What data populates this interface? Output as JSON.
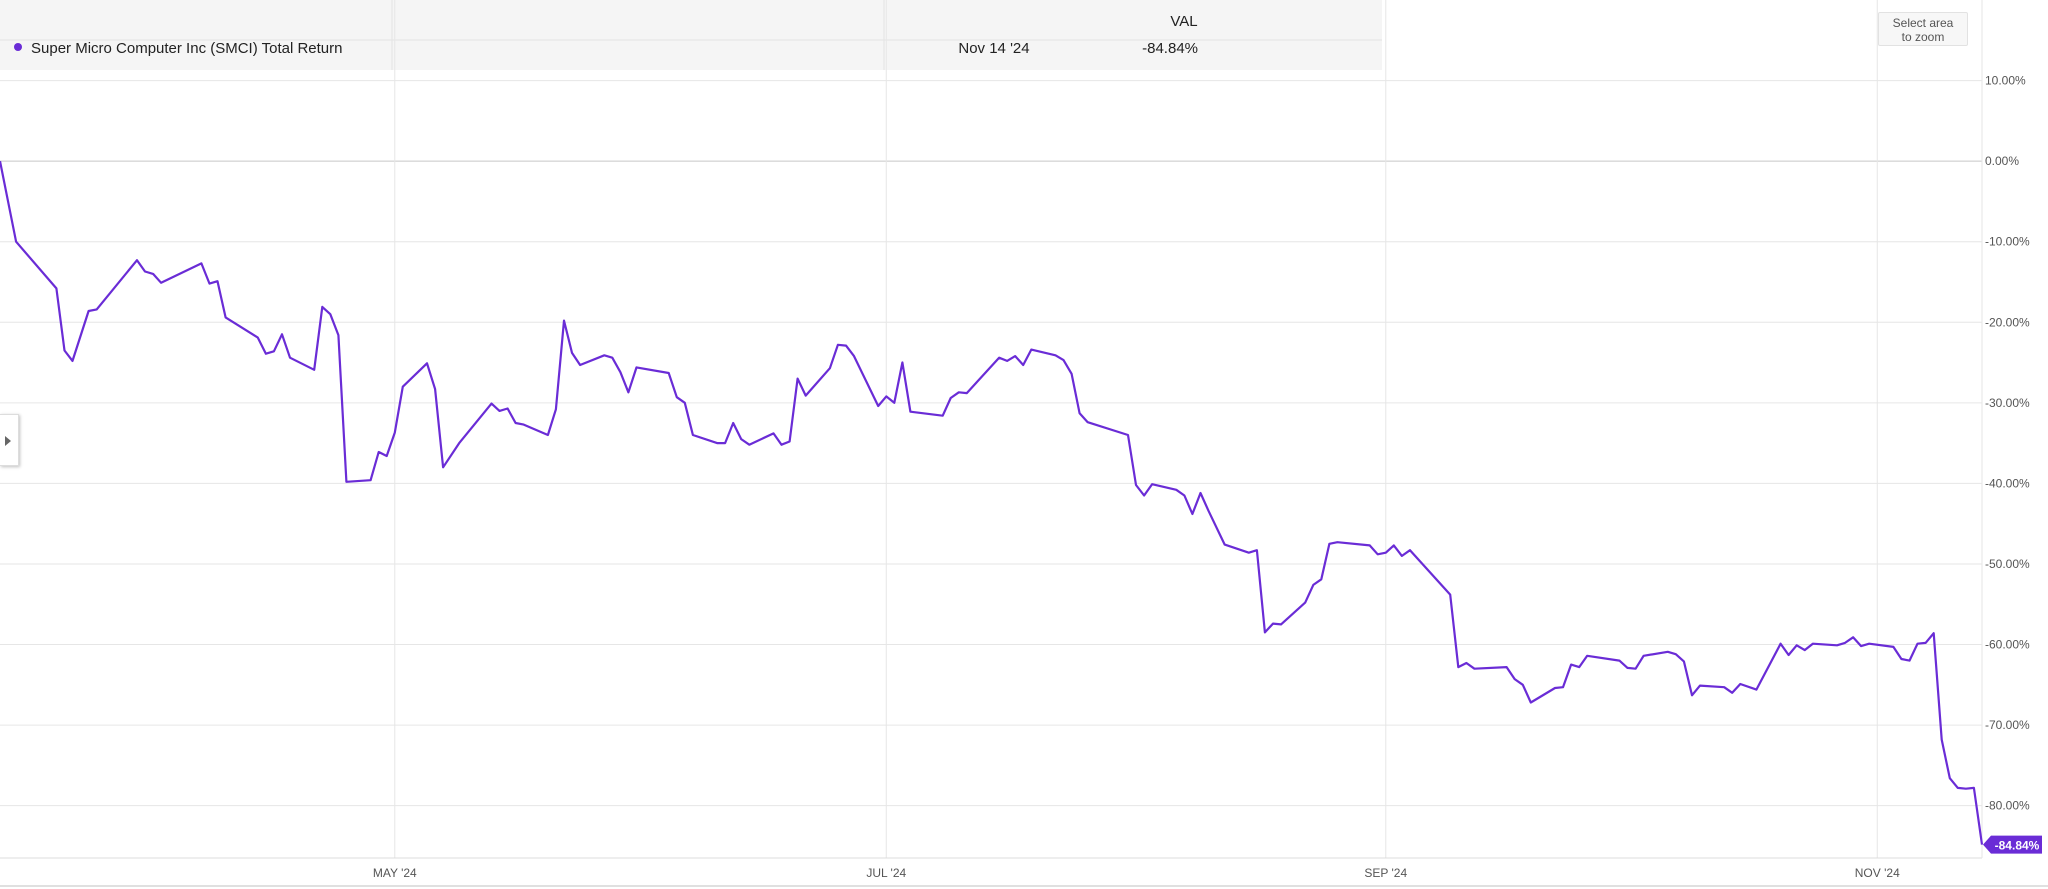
{
  "colors": {
    "series": "#6a2cd6",
    "grid": "#e6e6e6",
    "zero": "#c8c8c8",
    "badge": "#6a2cd6"
  },
  "legend": {
    "series_label": "Super Micro Computer Inc (SMCI) Total Return",
    "column_header": "VAL",
    "date": "Nov 14 '24",
    "value": "-84.84%"
  },
  "zoom_hint": {
    "line1": "Select area",
    "line2": "to zoom"
  },
  "chart_data": {
    "type": "line",
    "xlabel": "",
    "ylabel": "",
    "x_ticks": [
      {
        "label": "MAY '24",
        "date": "2024-05-01"
      },
      {
        "label": "JUL '24",
        "date": "2024-07-01"
      },
      {
        "label": "SEP '24",
        "date": "2024-09-01"
      },
      {
        "label": "NOV '24",
        "date": "2024-11-01"
      }
    ],
    "y_ticks": [
      {
        "label": "10.00%",
        "value": 10
      },
      {
        "label": "0.00%",
        "value": 0
      },
      {
        "label": "-10.00%",
        "value": -10
      },
      {
        "label": "-20.00%",
        "value": -20
      },
      {
        "label": "-30.00%",
        "value": -30
      },
      {
        "label": "-40.00%",
        "value": -40
      },
      {
        "label": "-50.00%",
        "value": -50
      },
      {
        "label": "-60.00%",
        "value": -60
      },
      {
        "label": "-70.00%",
        "value": -70
      },
      {
        "label": "-80.00%",
        "value": -80
      }
    ],
    "xlim": [
      "2024-03-13",
      "2024-11-14"
    ],
    "ylim": [
      -86.5,
      20
    ],
    "last_value_label": "-84.84%",
    "series": [
      {
        "name": "Super Micro Computer Inc (SMCI) Total Return",
        "points": [
          [
            "2024-03-13",
            0.0
          ],
          [
            "2024-03-15",
            -10.0
          ],
          [
            "2024-03-20",
            -15.8
          ],
          [
            "2024-03-21",
            -23.5
          ],
          [
            "2024-03-22",
            -24.8
          ],
          [
            "2024-03-24",
            -18.6
          ],
          [
            "2024-03-25",
            -18.4
          ],
          [
            "2024-03-30",
            -12.3
          ],
          [
            "2024-03-31",
            -13.7
          ],
          [
            "2024-04-01",
            -14.0
          ],
          [
            "2024-04-02",
            -15.1
          ],
          [
            "2024-04-07",
            -12.7
          ],
          [
            "2024-04-08",
            -15.2
          ],
          [
            "2024-04-09",
            -14.9
          ],
          [
            "2024-04-10",
            -19.4
          ],
          [
            "2024-04-14",
            -21.9
          ],
          [
            "2024-04-15",
            -23.9
          ],
          [
            "2024-04-16",
            -23.6
          ],
          [
            "2024-04-17",
            -21.5
          ],
          [
            "2024-04-18",
            -24.4
          ],
          [
            "2024-04-21",
            -25.9
          ],
          [
            "2024-04-22",
            -18.1
          ],
          [
            "2024-04-23",
            -19.0
          ],
          [
            "2024-04-24",
            -21.6
          ],
          [
            "2024-04-25",
            -39.8
          ],
          [
            "2024-04-28",
            -39.6
          ],
          [
            "2024-04-29",
            -36.1
          ],
          [
            "2024-04-30",
            -36.6
          ],
          [
            "2024-05-01",
            -33.7
          ],
          [
            "2024-05-02",
            -28.0
          ],
          [
            "2024-05-05",
            -25.1
          ],
          [
            "2024-05-06",
            -28.3
          ],
          [
            "2024-05-07",
            -38.0
          ],
          [
            "2024-05-09",
            -35.0
          ],
          [
            "2024-05-13",
            -30.1
          ],
          [
            "2024-05-14",
            -31.0
          ],
          [
            "2024-05-15",
            -30.7
          ],
          [
            "2024-05-16",
            -32.5
          ],
          [
            "2024-05-17",
            -32.7
          ],
          [
            "2024-05-20",
            -34.0
          ],
          [
            "2024-05-21",
            -30.8
          ],
          [
            "2024-05-22",
            -19.8
          ],
          [
            "2024-05-23",
            -23.8
          ],
          [
            "2024-05-24",
            -25.3
          ],
          [
            "2024-05-27",
            -24.1
          ],
          [
            "2024-05-28",
            -24.4
          ],
          [
            "2024-05-29",
            -26.2
          ],
          [
            "2024-05-30",
            -28.7
          ],
          [
            "2024-05-31",
            -25.6
          ],
          [
            "2024-06-04",
            -26.3
          ],
          [
            "2024-06-05",
            -29.3
          ],
          [
            "2024-06-06",
            -30.0
          ],
          [
            "2024-06-07",
            -34.0
          ],
          [
            "2024-06-10",
            -35.0
          ],
          [
            "2024-06-11",
            -35.0
          ],
          [
            "2024-06-12",
            -32.5
          ],
          [
            "2024-06-13",
            -34.5
          ],
          [
            "2024-06-14",
            -35.2
          ],
          [
            "2024-06-17",
            -33.8
          ],
          [
            "2024-06-18",
            -35.2
          ],
          [
            "2024-06-19",
            -34.8
          ],
          [
            "2024-06-20",
            -27.0
          ],
          [
            "2024-06-21",
            -29.1
          ],
          [
            "2024-06-24",
            -25.7
          ],
          [
            "2024-06-25",
            -22.8
          ],
          [
            "2024-06-26",
            -22.9
          ],
          [
            "2024-06-27",
            -24.2
          ],
          [
            "2024-06-30",
            -30.4
          ],
          [
            "2024-07-01",
            -29.2
          ],
          [
            "2024-07-02",
            -30.0
          ],
          [
            "2024-07-03",
            -25.0
          ],
          [
            "2024-07-04",
            -31.1
          ],
          [
            "2024-07-08",
            -31.6
          ],
          [
            "2024-07-09",
            -29.4
          ],
          [
            "2024-07-10",
            -28.7
          ],
          [
            "2024-07-11",
            -28.8
          ],
          [
            "2024-07-15",
            -24.4
          ],
          [
            "2024-07-16",
            -24.8
          ],
          [
            "2024-07-17",
            -24.2
          ],
          [
            "2024-07-18",
            -25.3
          ],
          [
            "2024-07-19",
            -23.4
          ],
          [
            "2024-07-22",
            -24.1
          ],
          [
            "2024-07-23",
            -24.7
          ],
          [
            "2024-07-24",
            -26.4
          ],
          [
            "2024-07-25",
            -31.3
          ],
          [
            "2024-07-26",
            -32.4
          ],
          [
            "2024-07-31",
            -34.0
          ],
          [
            "2024-08-01",
            -40.2
          ],
          [
            "2024-08-02",
            -41.5
          ],
          [
            "2024-08-03",
            -40.1
          ],
          [
            "2024-08-06",
            -40.8
          ],
          [
            "2024-08-07",
            -41.5
          ],
          [
            "2024-08-08",
            -43.8
          ],
          [
            "2024-08-09",
            -41.2
          ],
          [
            "2024-08-10",
            -43.4
          ],
          [
            "2024-08-12",
            -47.6
          ],
          [
            "2024-08-15",
            -48.6
          ],
          [
            "2024-08-16",
            -48.3
          ],
          [
            "2024-08-17",
            -58.5
          ],
          [
            "2024-08-18",
            -57.4
          ],
          [
            "2024-08-19",
            -57.5
          ],
          [
            "2024-08-22",
            -54.8
          ],
          [
            "2024-08-23",
            -52.6
          ],
          [
            "2024-08-24",
            -51.9
          ],
          [
            "2024-08-25",
            -47.5
          ],
          [
            "2024-08-26",
            -47.3
          ],
          [
            "2024-08-30",
            -47.7
          ],
          [
            "2024-08-31",
            -48.8
          ],
          [
            "2024-09-01",
            -48.6
          ],
          [
            "2024-09-02",
            -47.7
          ],
          [
            "2024-09-03",
            -49.0
          ],
          [
            "2024-09-04",
            -48.3
          ],
          [
            "2024-09-09",
            -53.8
          ],
          [
            "2024-09-10",
            -62.8
          ],
          [
            "2024-09-11",
            -62.3
          ],
          [
            "2024-09-12",
            -63.0
          ],
          [
            "2024-09-16",
            -62.8
          ],
          [
            "2024-09-17",
            -64.3
          ],
          [
            "2024-09-18",
            -65.0
          ],
          [
            "2024-09-19",
            -67.2
          ],
          [
            "2024-09-22",
            -65.4
          ],
          [
            "2024-09-23",
            -65.3
          ],
          [
            "2024-09-24",
            -62.5
          ],
          [
            "2024-09-25",
            -62.8
          ],
          [
            "2024-09-26",
            -61.4
          ],
          [
            "2024-09-30",
            -62.0
          ],
          [
            "2024-10-01",
            -62.9
          ],
          [
            "2024-10-02",
            -63.0
          ],
          [
            "2024-10-03",
            -61.4
          ],
          [
            "2024-10-06",
            -60.9
          ],
          [
            "2024-10-07",
            -61.2
          ],
          [
            "2024-10-08",
            -62.1
          ],
          [
            "2024-10-09",
            -66.3
          ],
          [
            "2024-10-10",
            -65.1
          ],
          [
            "2024-10-13",
            -65.3
          ],
          [
            "2024-10-14",
            -66.0
          ],
          [
            "2024-10-15",
            -64.9
          ],
          [
            "2024-10-17",
            -65.6
          ],
          [
            "2024-10-20",
            -59.9
          ],
          [
            "2024-10-21",
            -61.3
          ],
          [
            "2024-10-22",
            -60.1
          ],
          [
            "2024-10-23",
            -60.7
          ],
          [
            "2024-10-24",
            -59.9
          ],
          [
            "2024-10-27",
            -60.1
          ],
          [
            "2024-10-28",
            -59.8
          ],
          [
            "2024-10-29",
            -59.1
          ],
          [
            "2024-10-30",
            -60.2
          ],
          [
            "2024-10-31",
            -59.9
          ],
          [
            "2024-11-03",
            -60.3
          ],
          [
            "2024-11-04",
            -61.8
          ],
          [
            "2024-11-05",
            -62.0
          ],
          [
            "2024-11-06",
            -59.9
          ],
          [
            "2024-11-07",
            -59.8
          ],
          [
            "2024-11-08",
            -58.6
          ],
          [
            "2024-11-09",
            -71.8
          ],
          [
            "2024-11-10",
            -76.6
          ],
          [
            "2024-11-11",
            -77.8
          ],
          [
            "2024-11-12",
            -77.9
          ],
          [
            "2024-11-13",
            -77.8
          ],
          [
            "2024-11-14",
            -84.84
          ]
        ]
      }
    ]
  }
}
